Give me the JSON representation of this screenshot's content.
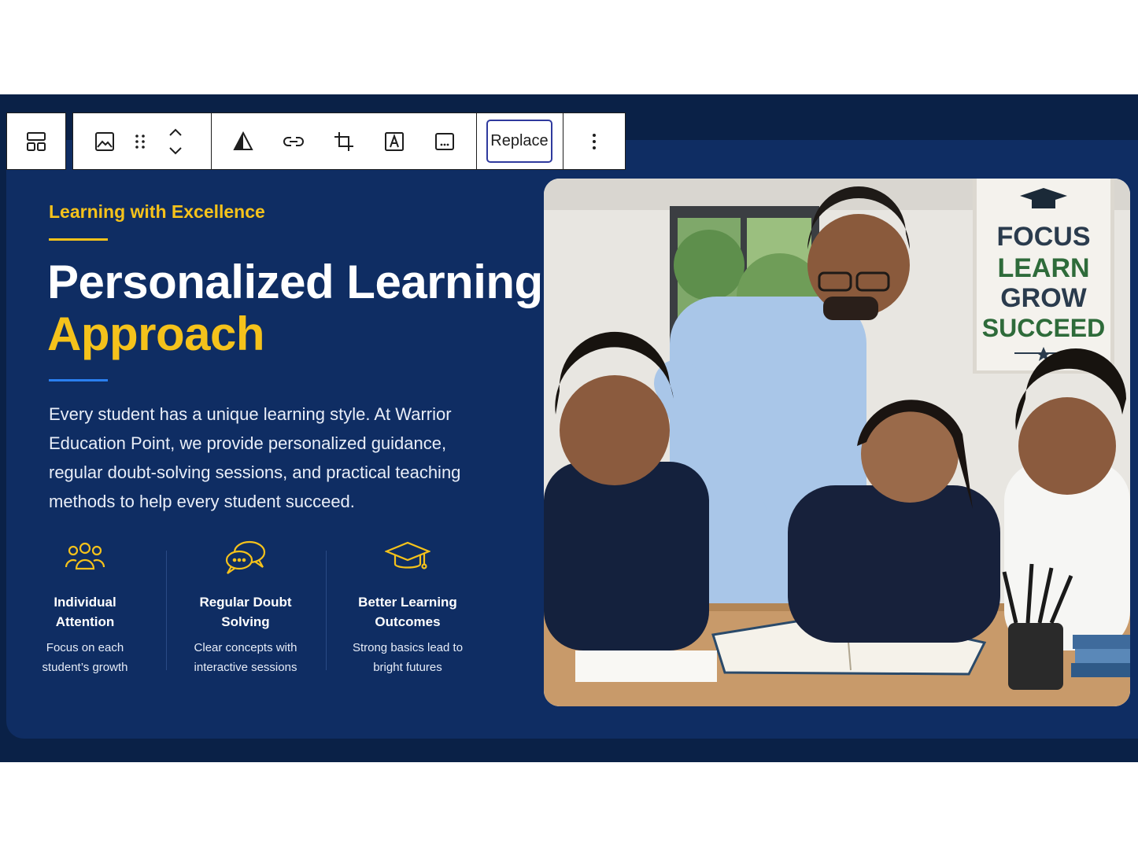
{
  "toolbar": {
    "replace_label": "Replace",
    "icons": [
      "block-layout-icon",
      "image-icon",
      "drag-handle-icon",
      "move-up-icon",
      "move-down-icon",
      "duotone-filter-icon",
      "link-icon",
      "crop-icon",
      "text-overlay-icon",
      "caption-icon",
      "more-options-icon"
    ]
  },
  "content": {
    "eyebrow": "Learning with Excellence",
    "title_line1": "Personalized Learning",
    "title_line2": "Approach",
    "paragraph": "Every student has a unique learning style. At Warrior Education Point, we provide personalized guidance, regular doubt-solving sessions, and practical teaching methods to help every student succeed."
  },
  "features": [
    {
      "icon": "users-icon",
      "title_line1": "Individual",
      "title_line2": "Attention",
      "desc_line1": "Focus on each",
      "desc_line2": "student’s growth"
    },
    {
      "icon": "chat-bubbles-icon",
      "title_line1": "Regular Doubt",
      "title_line2": "Solving",
      "desc_line1": "Clear concepts with",
      "desc_line2": "interactive sessions"
    },
    {
      "icon": "graduation-cap-icon",
      "title_line1": "Better Learning",
      "title_line2": "Outcomes",
      "desc_line1": "Strong basics lead to",
      "desc_line2": "bright futures"
    }
  ],
  "poster": {
    "lines": [
      "FOCUS",
      "LEARN",
      "GROW",
      "SUCCEED"
    ]
  },
  "colors": {
    "accent_yellow": "#f5c21b",
    "accent_blue": "#2a7ff0",
    "navy": "#0f2d63",
    "poster_green": "#2e6b3a"
  }
}
